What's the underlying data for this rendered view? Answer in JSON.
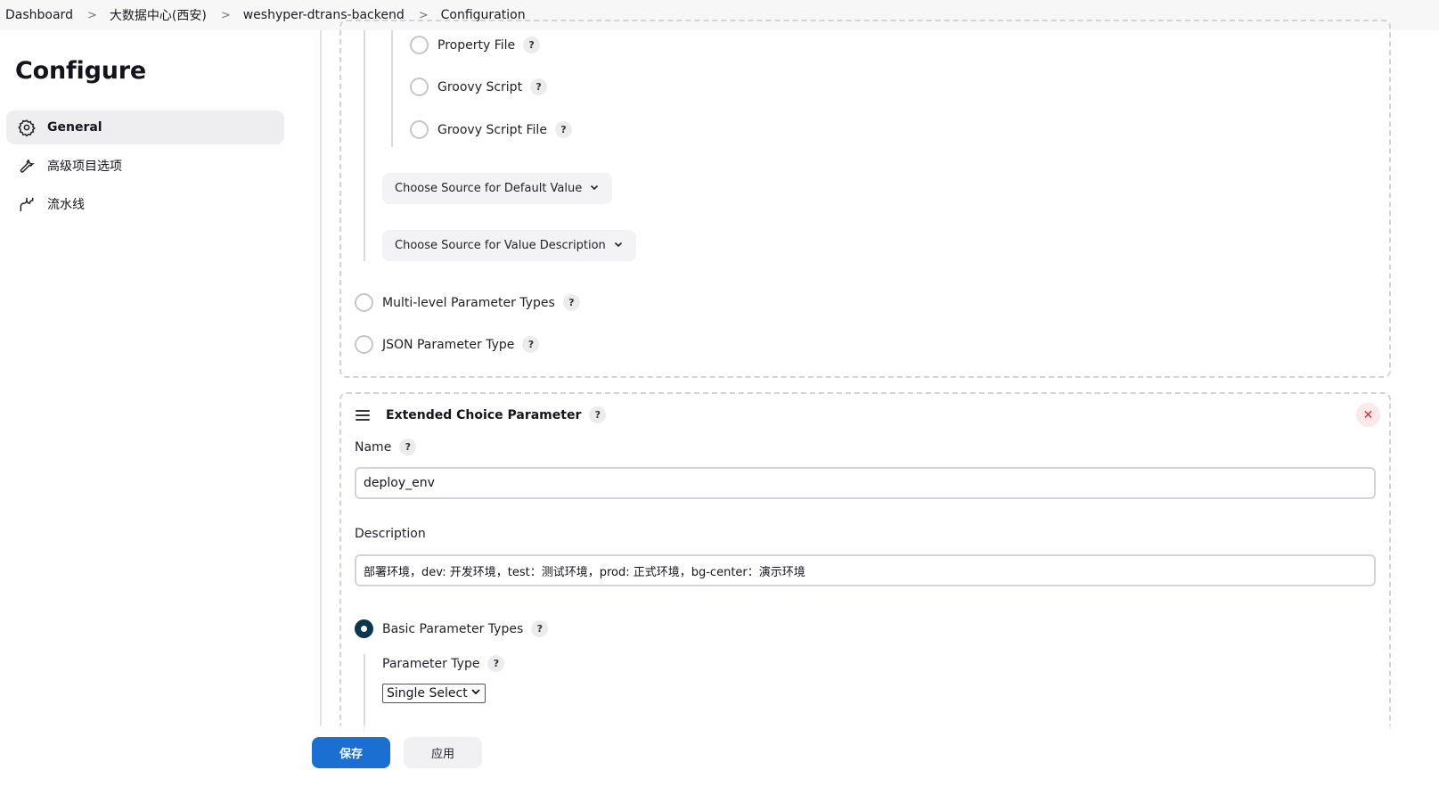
{
  "breadcrumb": {
    "items": [
      "Dashboard",
      "大数据中心(西安)",
      "weshyper-dtrans-backend",
      "Configuration"
    ],
    "separator": ">"
  },
  "sidebar": {
    "title": "Configure",
    "items": [
      {
        "label": "General",
        "icon": "gear-icon",
        "active": true
      },
      {
        "label": "高级项目选项",
        "icon": "wrench-icon",
        "active": false
      },
      {
        "label": "流水线",
        "icon": "pipeline-icon",
        "active": false
      }
    ]
  },
  "upper_section": {
    "sub_options": [
      "Property File",
      "Groovy Script",
      "Groovy Script File"
    ],
    "default_value_dropdown": "Choose Source for Default Value",
    "value_description_dropdown": "Choose Source for Value Description",
    "parameter_types": [
      "Multi-level Parameter Types",
      "JSON Parameter Type"
    ]
  },
  "extended_choice": {
    "title": "Extended Choice Parameter",
    "name_label": "Name",
    "name_value": "deploy_env",
    "description_label": "Description",
    "description_value": "部署环境，dev: 开发环境，test：测试环境，prod: 正式环境，bg-center：演示环境",
    "basic_types_label": "Basic Parameter Types",
    "basic_types_selected": true,
    "parameter_type_label": "Parameter Type",
    "parameter_type_value": "Single Select"
  },
  "help_glyph": "?",
  "close_glyph": "✕",
  "buttons": {
    "save": "保存",
    "apply": "应用"
  },
  "colors": {
    "primary": "#1b6fd1",
    "radio_checked": "#0b3551",
    "close": "#d42a3a"
  }
}
